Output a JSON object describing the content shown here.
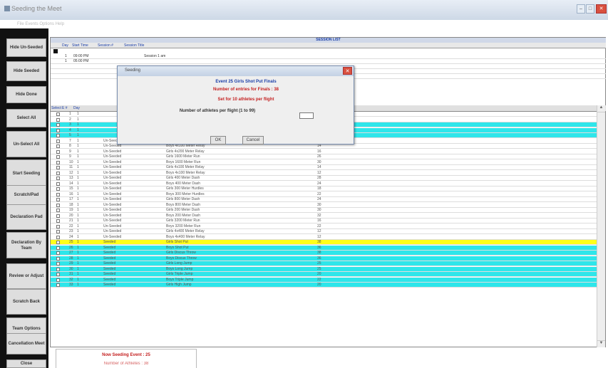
{
  "window": {
    "title": "Seeding the Meet",
    "menu": "File  Events  Options  Help"
  },
  "sidebar": [
    {
      "label": "Hide Un-Seeded"
    },
    {
      "label": "Hide Seeded"
    },
    {
      "label": "Hide Done"
    },
    {
      "label": "Select All"
    },
    {
      "label": "Un-Select All"
    },
    {
      "label": "Start Seeding"
    },
    {
      "label": "Scratch/Pad"
    },
    {
      "label": "Declaration Pad"
    },
    {
      "label": "Declaration By Team"
    },
    {
      "label": "Review or Adjust"
    },
    {
      "label": "Scratch Back"
    },
    {
      "label": "Team Options"
    },
    {
      "label": "Cancellation Meet"
    },
    {
      "label": "Close"
    }
  ],
  "session_list": {
    "title": "SESSION LIST",
    "columns": [
      "Day",
      "Start Time",
      "Session #",
      "Session Title"
    ],
    "rows": [
      {
        "day": "1",
        "time": "09:00 PM",
        "num": "1",
        "title": "Session 1 am"
      },
      {
        "day": "1",
        "time": "05:00 PM",
        "num": "2",
        "title": "Session 2 pm"
      }
    ]
  },
  "events_header": [
    "Select",
    "E #",
    "Day",
    "Status",
    "",
    "Event",
    "",
    "#"
  ],
  "events": [
    {
      "num": "1",
      "day": "1",
      "status": "",
      "event": "",
      "entries": "",
      "hl": ""
    },
    {
      "num": "2",
      "day": "1",
      "status": "",
      "event": "",
      "entries": "",
      "hl": ""
    },
    {
      "num": "3",
      "day": "1",
      "status": "",
      "event": "",
      "entries": "",
      "hl": "cyan"
    },
    {
      "num": "4",
      "day": "1",
      "status": "",
      "event": "",
      "entries": "",
      "hl": "cyan"
    },
    {
      "num": "5",
      "day": "1",
      "status": "",
      "event": "",
      "entries": "",
      "hl": "cyan"
    },
    {
      "num": "7",
      "day": "1",
      "status": "Un-Seeded",
      "event": "Boys 100 Meter Dash",
      "entries": "32",
      "hl": ""
    },
    {
      "num": "8",
      "day": "1",
      "status": "Un-Seeded",
      "event": "Boys 4x100 Meter Relay",
      "entries": "14",
      "hl": ""
    },
    {
      "num": "9",
      "day": "1",
      "status": "Un-Seeded",
      "event": "Girls 4x200 Meter Relay",
      "entries": "16",
      "hl": ""
    },
    {
      "num": "9",
      "day": "1",
      "status": "Un-Seeded",
      "event": "Girls 1600 Meter Run",
      "entries": "26",
      "hl": ""
    },
    {
      "num": "10",
      "day": "1",
      "status": "Un-Seeded",
      "event": "Boys 1600 Meter Run",
      "entries": "30",
      "hl": ""
    },
    {
      "num": "11",
      "day": "1",
      "status": "Un-Seeded",
      "event": "Girls 4x100 Meter Relay",
      "entries": "14",
      "hl": ""
    },
    {
      "num": "12",
      "day": "1",
      "status": "Un-Seeded",
      "event": "Boys 4x100 Meter Relay",
      "entries": "12",
      "hl": ""
    },
    {
      "num": "13",
      "day": "1",
      "status": "Un-Seeded",
      "event": "Girls 400 Meter Dash",
      "entries": "28",
      "hl": ""
    },
    {
      "num": "14",
      "day": "1",
      "status": "Un-Seeded",
      "event": "Boys 400 Meter Dash",
      "entries": "24",
      "hl": ""
    },
    {
      "num": "15",
      "day": "1",
      "status": "Un-Seeded",
      "event": "Girls 300 Meter Hurdles",
      "entries": "18",
      "hl": ""
    },
    {
      "num": "16",
      "day": "1",
      "status": "Un-Seeded",
      "event": "Boys 300 Meter Hurdles",
      "entries": "22",
      "hl": ""
    },
    {
      "num": "17",
      "day": "1",
      "status": "Un-Seeded",
      "event": "Girls 800 Meter Dash",
      "entries": "24",
      "hl": ""
    },
    {
      "num": "18",
      "day": "1",
      "status": "Un-Seeded",
      "event": "Boys 800 Meter Dash",
      "entries": "30",
      "hl": ""
    },
    {
      "num": "19",
      "day": "1",
      "status": "Un-Seeded",
      "event": "Girls 200 Meter Dash",
      "entries": "30",
      "hl": ""
    },
    {
      "num": "20",
      "day": "1",
      "status": "Un-Seeded",
      "event": "Boys 200 Meter Dash",
      "entries": "32",
      "hl": ""
    },
    {
      "num": "21",
      "day": "1",
      "status": "Un-Seeded",
      "event": "Girls 3200 Meter Run",
      "entries": "16",
      "hl": ""
    },
    {
      "num": "22",
      "day": "1",
      "status": "Un-Seeded",
      "event": "Boys 3200 Meter Run",
      "entries": "22",
      "hl": ""
    },
    {
      "num": "23",
      "day": "1",
      "status": "Un-Seeded",
      "event": "Girls 4x400 Meter Relay",
      "entries": "12",
      "hl": ""
    },
    {
      "num": "24",
      "day": "1",
      "status": "Un-Seeded",
      "event": "Boys 4x400 Meter Relay",
      "entries": "12",
      "hl": ""
    },
    {
      "num": "25",
      "day": "1",
      "status": "Seeded",
      "event": "Girls Shot Put",
      "entries": "38",
      "hl": "yellow"
    },
    {
      "num": "26",
      "day": "1",
      "status": "Seeded",
      "event": "Boys Shot Put",
      "entries": "36",
      "hl": "cyan"
    },
    {
      "num": "27",
      "day": "1",
      "status": "Seeded",
      "event": "Girls Discus Throw",
      "entries": "38",
      "hl": "cyan"
    },
    {
      "num": "28",
      "day": "1",
      "status": "Seeded",
      "event": "Boys Discus Throw",
      "entries": "36",
      "hl": "cyan"
    },
    {
      "num": "29",
      "day": "1",
      "status": "Seeded",
      "event": "Girls Long Jump",
      "entries": "25",
      "hl": "cyan"
    },
    {
      "num": "30",
      "day": "1",
      "status": "Seeded",
      "event": "Boys Long Jump",
      "entries": "25",
      "hl": "cyan"
    },
    {
      "num": "31",
      "day": "1",
      "status": "Seeded",
      "event": "Girls Triple Jump",
      "entries": "20",
      "hl": "cyan"
    },
    {
      "num": "32",
      "day": "1",
      "status": "Seeded",
      "event": "Boys Triple Jump",
      "entries": "22",
      "hl": "cyan"
    },
    {
      "num": "33",
      "day": "1",
      "status": "Seeded",
      "event": "Girls High Jump",
      "entries": "20",
      "hl": "cyan"
    }
  ],
  "dialog": {
    "title": "Seeding",
    "line1": "Event 25 Girls Shot Put Finals",
    "line2": "Number of entries for Finals : 38",
    "line3": "Set for 10 athletes per flight",
    "line4": "Number of athletes per flight (1 to 99)",
    "input_value": "",
    "ok": "OK",
    "cancel": "Cancel"
  },
  "status": {
    "line1": "Now Seeding Event : 25",
    "line2": "Number of Athletes : 38"
  },
  "colors": {
    "cyan": "#2ee6ea",
    "yellow": "#ffff1a",
    "status_red": "#c42020",
    "dialog_blue": "#1a3ea8"
  }
}
